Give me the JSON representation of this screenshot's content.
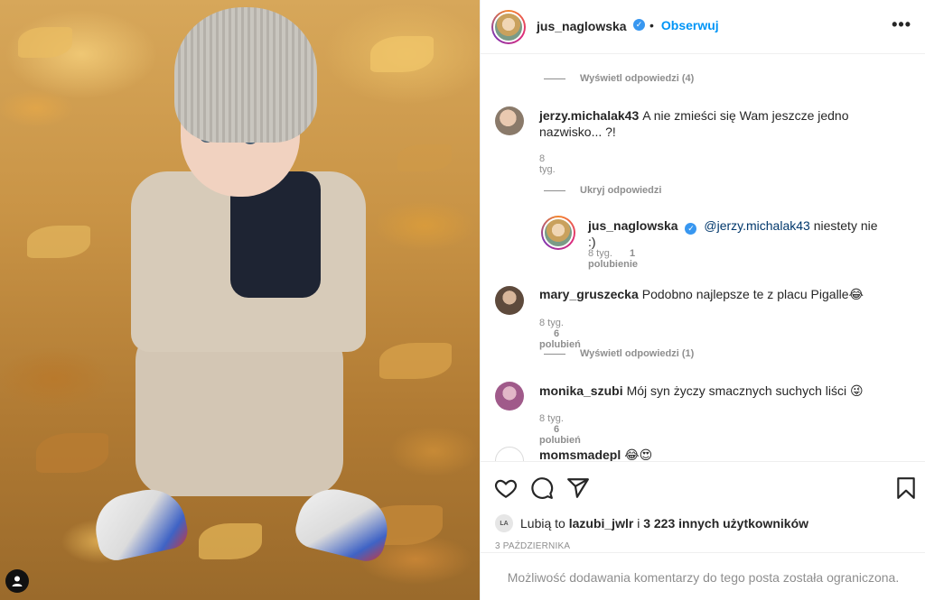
{
  "post": {
    "author": "jus_naglowska",
    "follow_label": "Obserwuj",
    "separator": "•",
    "more_label": "•••"
  },
  "comments": {
    "show_replies_1": "Wyświetl odpowiedzi (4)",
    "c1_user": "jerzy.michalak43",
    "c1_text": "A nie zmieści się Wam jeszcze jedno nazwisko... ?!",
    "c1_time": "8 tyg.",
    "hide_replies": "Ukryj odpowiedzi",
    "r1_user": "jus_naglowska",
    "r1_mention": "@jerzy.michalak43",
    "r1_text": "niestety nie :)",
    "r1_time": "8 tyg.",
    "r1_likes": "1 polubienie",
    "c2_user": "mary_gruszecka",
    "c2_text": "Podobno najlepsze te z placu Pigalle😂",
    "c2_time": "8 tyg.",
    "c2_likes": "6 polubień",
    "show_replies_2": "Wyświetl odpowiedzi (1)",
    "c3_user": "monika_szubi",
    "c3_text": "Mój syn życzy smacznych suchych liści 😜",
    "c3_time": "8 tyg.",
    "c3_likes": "6 polubień",
    "c4_user": "momsmadepl",
    "c4_text": "😂😍"
  },
  "footer": {
    "liked_avatar_text": "LA",
    "liked_prefix": "Lubią to",
    "liked_user": "lazubi_jwlr",
    "liked_mid": "i",
    "liked_count": "3 223 innych użytkowników",
    "date": "3 PAŹDZIERNIKA",
    "restricted": "Możliwość dodawania komentarzy do tego posta została ograniczona."
  },
  "icons": {
    "like": "heart-icon",
    "comment": "comment-icon",
    "share": "share-icon",
    "save": "bookmark-icon",
    "verified": "verified-badge-icon",
    "user": "user-icon"
  },
  "colors": {
    "link": "#0095f6",
    "muted": "#8e8e8e",
    "text": "#262626"
  }
}
